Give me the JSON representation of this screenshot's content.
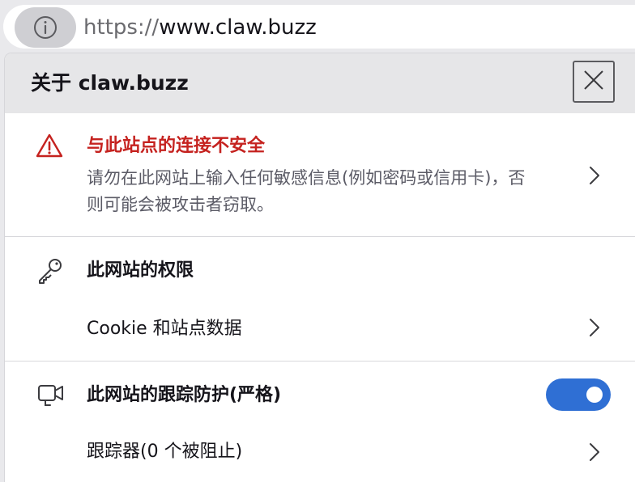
{
  "address_bar": {
    "url_scheme": "https://",
    "url_host": "www.claw.buzz",
    "info_icon": "info-circle-icon"
  },
  "panel": {
    "title": "关于 claw.buzz",
    "close_icon": "close-icon",
    "security": {
      "icon": "warning-triangle-icon",
      "title": "与此站点的连接不安全",
      "description": "请勿在此网站上输入任何敏感信息(例如密码或信用卡)，否则可能会被攻击者窃取。",
      "title_color": "#c5221f"
    },
    "permissions": {
      "icon": "key-icon",
      "title": "此网站的权限",
      "cookie_label": "Cookie 和站点数据"
    },
    "tracking": {
      "icon": "tracking-camera-icon",
      "title": "此网站的跟踪防护(严格)",
      "toggle_on": true,
      "toggle_color": "#2f6fd4",
      "trackers_label": "跟踪器(0 个被阻止)"
    }
  }
}
